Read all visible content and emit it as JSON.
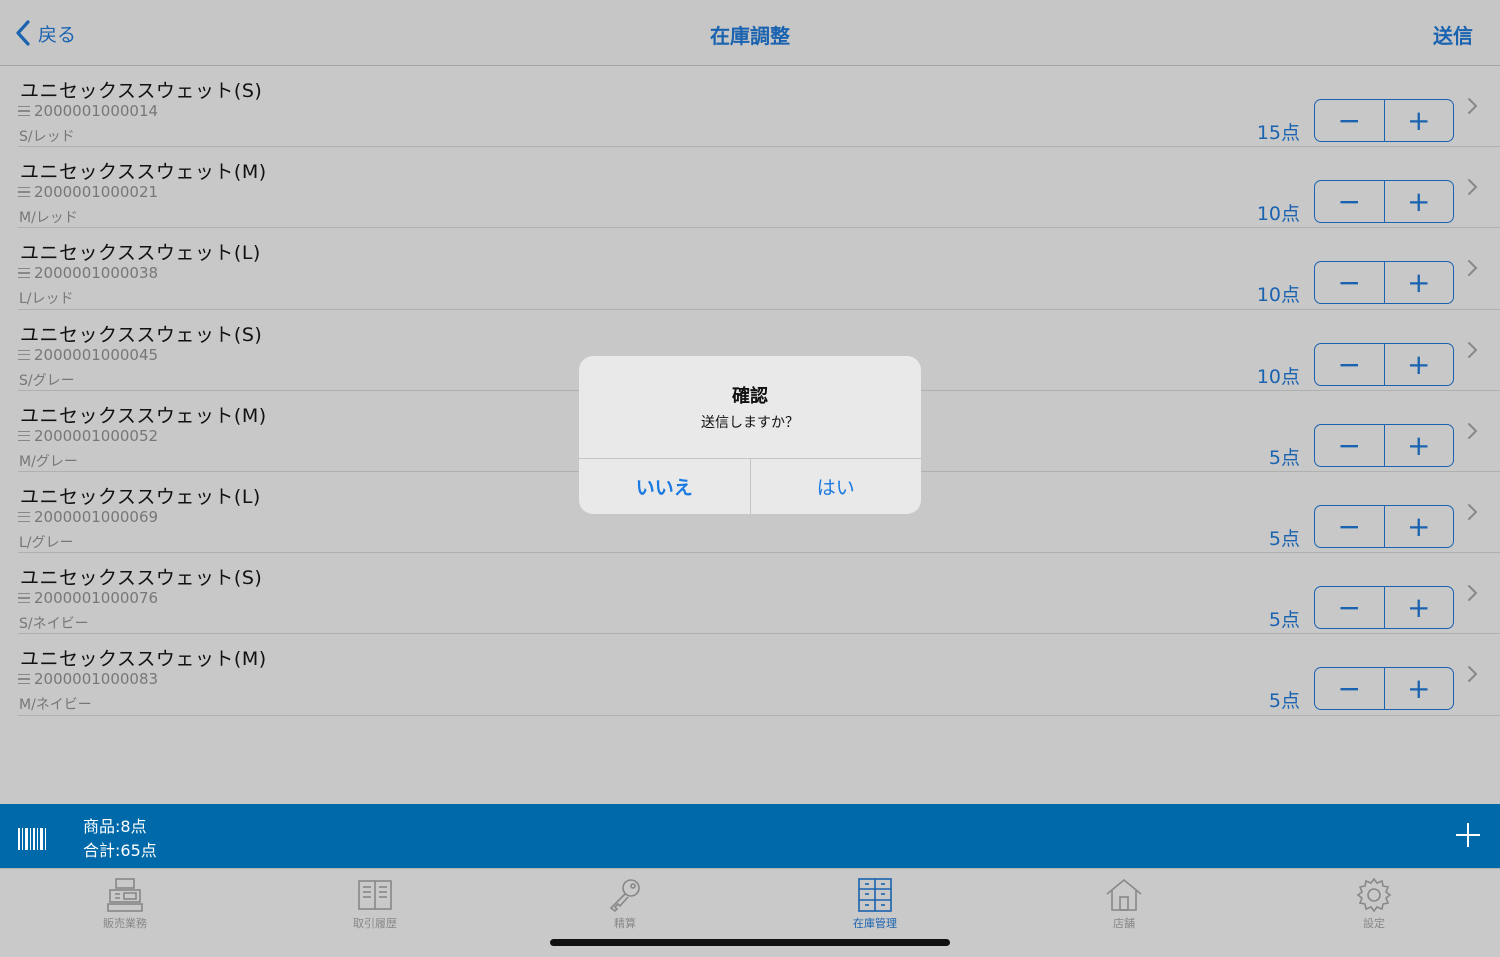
{
  "nav": {
    "back_label": "戻る",
    "title": "在庫調整",
    "send_label": "送信"
  },
  "items": [
    {
      "name": "ユニセックススウェット(S)",
      "code": "2000001000014",
      "variant": "S/レッド",
      "qty": "15点"
    },
    {
      "name": "ユニセックススウェット(M)",
      "code": "2000001000021",
      "variant": "M/レッド",
      "qty": "10点"
    },
    {
      "name": "ユニセックススウェット(L)",
      "code": "2000001000038",
      "variant": "L/レッド",
      "qty": "10点"
    },
    {
      "name": "ユニセックススウェット(S)",
      "code": "2000001000045",
      "variant": "S/グレー",
      "qty": "10点"
    },
    {
      "name": "ユニセックススウェット(M)",
      "code": "2000001000052",
      "variant": "M/グレー",
      "qty": "5点"
    },
    {
      "name": "ユニセックススウェット(L)",
      "code": "2000001000069",
      "variant": "L/グレー",
      "qty": "5点"
    },
    {
      "name": "ユニセックススウェット(S)",
      "code": "2000001000076",
      "variant": "S/ネイビー",
      "qty": "5点"
    },
    {
      "name": "ユニセックススウェット(M)",
      "code": "2000001000083",
      "variant": "M/ネイビー",
      "qty": "5点"
    }
  ],
  "summary": {
    "items_label": "商品:8点",
    "total_label": "合計:65点"
  },
  "tabs": [
    {
      "label": "販売業務",
      "icon": "register-icon"
    },
    {
      "label": "取引履歴",
      "icon": "ledger-icon"
    },
    {
      "label": "精算",
      "icon": "key-icon"
    },
    {
      "label": "在庫管理",
      "icon": "cabinet-icon",
      "active": true
    },
    {
      "label": "店舗",
      "icon": "house-icon"
    },
    {
      "label": "設定",
      "icon": "gear-icon"
    }
  ],
  "dialog": {
    "title": "確認",
    "message": "送信しますか？",
    "no_label": "いいえ",
    "yes_label": "はい"
  },
  "colors": {
    "accent": "#1a63b0",
    "summary_bar": "#0069a9",
    "dialog_button": "#1a7ae0"
  }
}
